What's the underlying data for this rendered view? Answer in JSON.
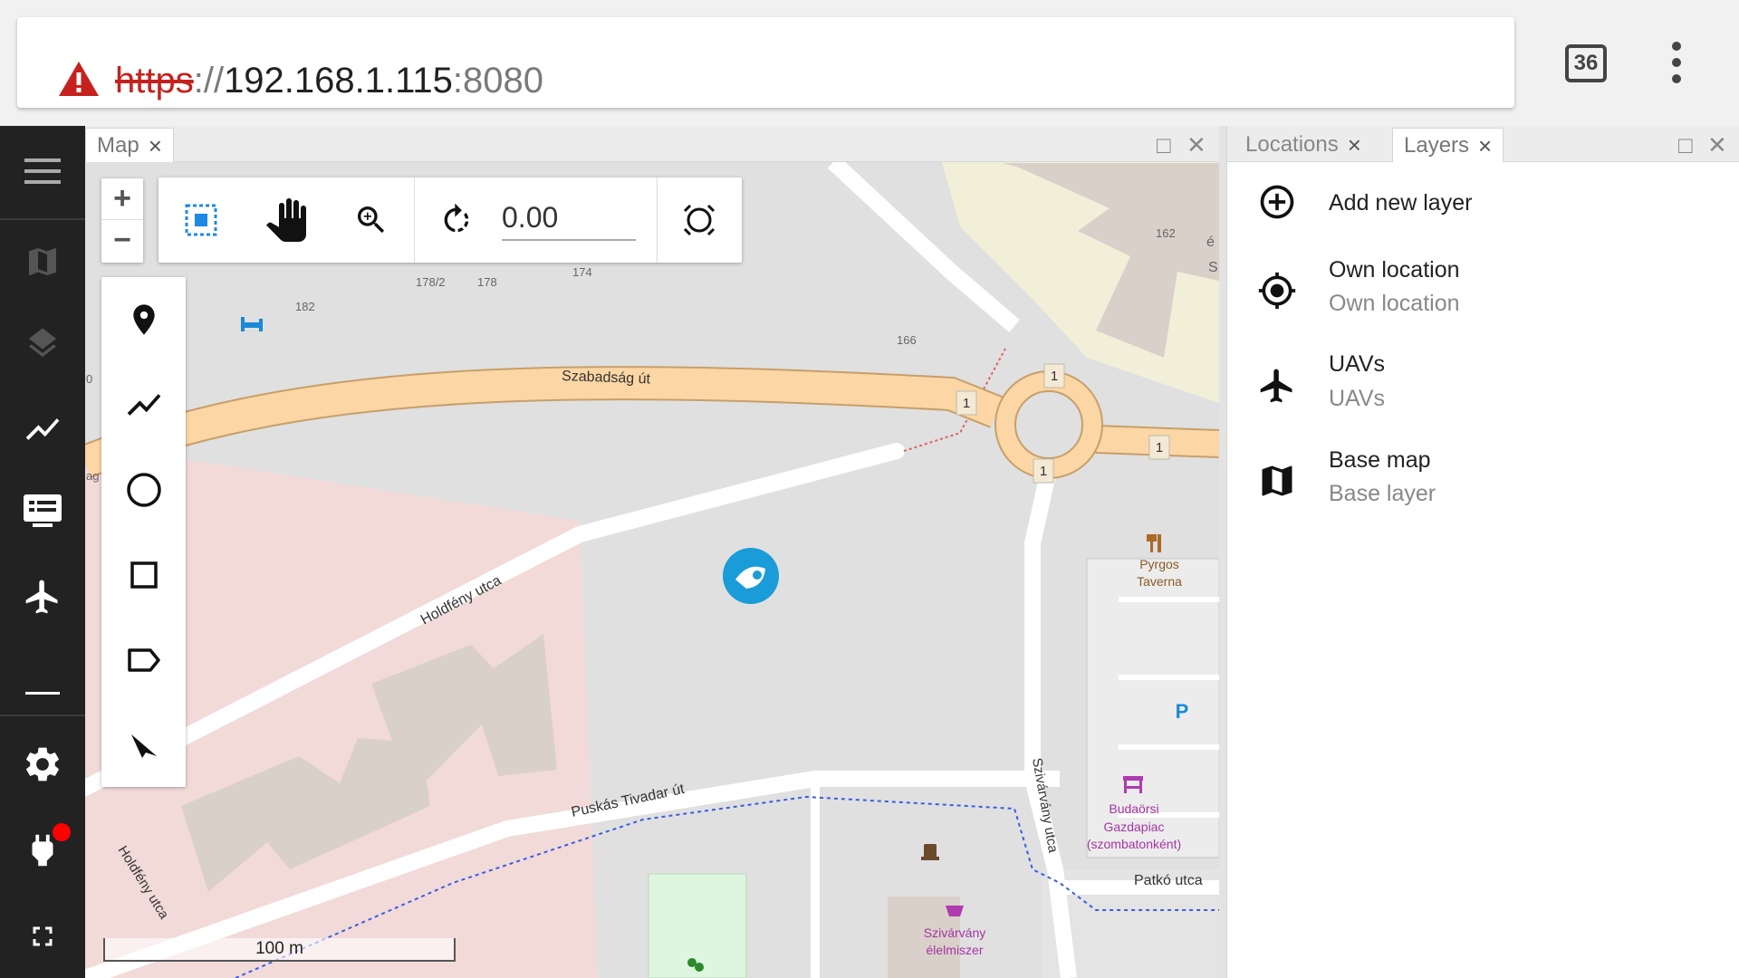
{
  "browser": {
    "url_scheme": "https",
    "url_sep": "://",
    "url_host": "192.168.1.115",
    "url_port": ":8080",
    "tab_count": "36"
  },
  "map_pane": {
    "tab_label": "Map",
    "tab_close": "×",
    "maximize": "□",
    "close": "✕"
  },
  "right_pane": {
    "tabs": [
      {
        "label": "Locations",
        "close": "×"
      },
      {
        "label": "Layers",
        "close": "×",
        "active": true
      }
    ],
    "maximize": "□",
    "close": "✕",
    "layers": [
      {
        "title": "Add new layer",
        "subtitle": "",
        "icon": "add-circle-icon"
      },
      {
        "title": "Own location",
        "subtitle": "Own location",
        "icon": "crosshair-icon"
      },
      {
        "title": "UAVs",
        "subtitle": "UAVs",
        "icon": "airplane-icon"
      },
      {
        "title": "Base map",
        "subtitle": "Base layer",
        "icon": "map-icon"
      }
    ]
  },
  "toolbar": {
    "zoom_in": "+",
    "zoom_out": "−",
    "rotation_value": "0.00"
  },
  "map_labels": {
    "street_szabadsag": "Szabadság út",
    "street_holdfeny": "Holdfény utca",
    "street_holdfeny2": "Holdfény utca",
    "street_puskas": "Puskás Tivadar út",
    "street_szivarvany": "Szivárvány utca",
    "street_patko": "Patkó utca",
    "house_162": "162",
    "house_166": "166",
    "house_174": "174",
    "house_178": "178",
    "house_178_2": "178/2",
    "house_182": "182",
    "road_ref_1": "1",
    "poi_pyrgos_1": "Pyrgos",
    "poi_pyrgos_2": "Taverna",
    "poi_market_1": "Budaörsi",
    "poi_market_2": "Gazdapiac",
    "poi_market_3": "(szombatonként)",
    "poi_shop_1": "Szivárvány",
    "poi_shop_2": "élelmiszer",
    "parking": "P",
    "edge_e": "é",
    "edge_s": "S",
    "edge_0": "0",
    "edge_ag": "ag"
  },
  "scale_bar": "100 m",
  "colors": {
    "nav_bg": "#222222",
    "road_major": "#fcd6a4",
    "landuse_residential": "#f2dad9",
    "building": "#d9d0c9",
    "accent_blue": "#1a9cd8",
    "alert_red": "#ff0000"
  }
}
